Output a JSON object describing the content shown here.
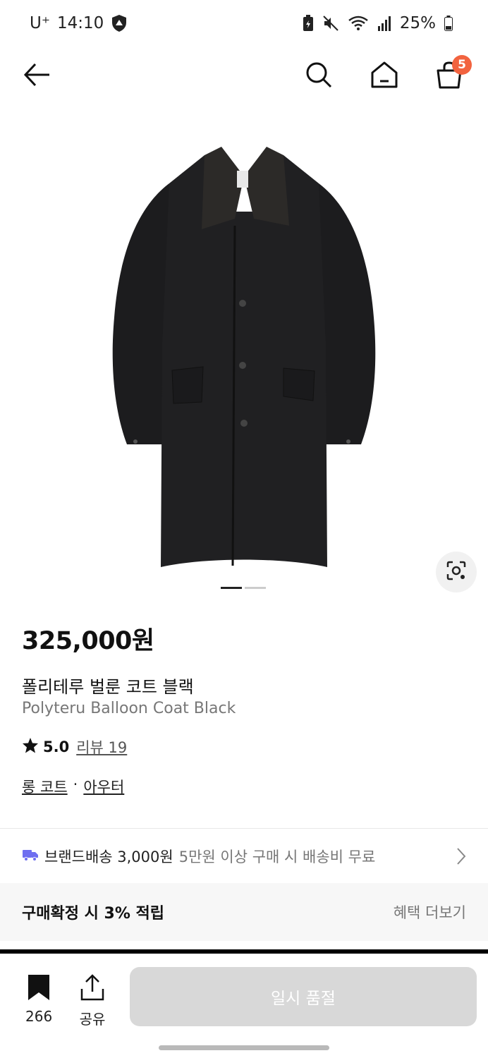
{
  "colors": {
    "accent_badge": "#f2633f",
    "shipping_icon": "#6f6ff0",
    "soldout_bg": "#d8d8d8",
    "benefit_bg": "#f7f7f7"
  },
  "status_bar": {
    "carrier": "U⁺",
    "time": "14:10",
    "battery_percent": "25%",
    "icons": [
      "shield-icon",
      "battery-saver-icon",
      "mute-icon",
      "wifi-icon",
      "signal-icon",
      "battery-icon"
    ]
  },
  "nav": {
    "icons": [
      "back-arrow-icon",
      "search-icon",
      "home-icon",
      "cart-icon"
    ],
    "cart_count": "5"
  },
  "gallery": {
    "image_alt": "black long coat",
    "page_count": 2,
    "current_page": 1
  },
  "product": {
    "price": "325,000원",
    "name_ko": "폴리테루 벌룬 코트 블랙",
    "name_en": "Polyteru Balloon Coat Black",
    "rating": "5.0",
    "review_label": "리뷰 19",
    "category_1": "롱 코트",
    "category_separator": "·",
    "category_2": "아우터"
  },
  "shipping": {
    "main": "브랜드배송 3,000원",
    "sub": "5만원 이상 구매 시 배송비 무료"
  },
  "benefit": {
    "title": "구매확정 시 3% 적립",
    "more": "혜택 더보기"
  },
  "bottom": {
    "bookmark_count": "266",
    "share_label": "공유",
    "soldout_label": "일시 품절"
  }
}
